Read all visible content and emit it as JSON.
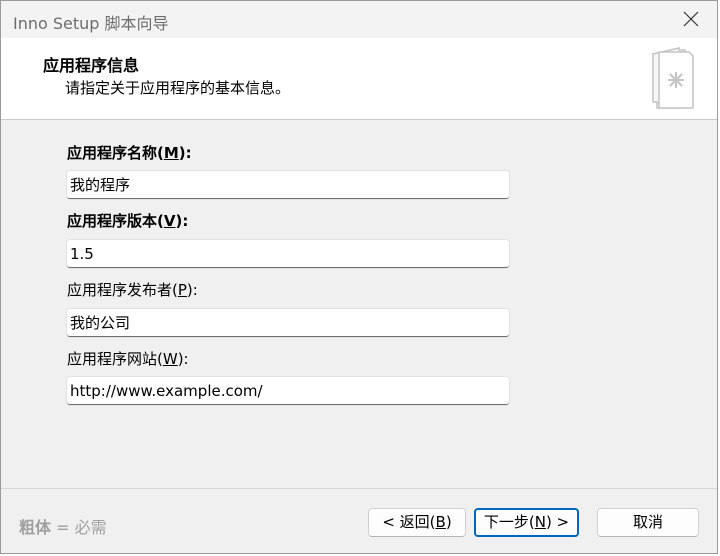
{
  "window": {
    "title": "Inno Setup 脚本向导"
  },
  "header": {
    "title": "应用程序信息",
    "description": "请指定关于应用程序的基本信息。"
  },
  "fields": [
    {
      "label_prefix": "应用程序名称(",
      "mnemonic": "M",
      "label_suffix": "):",
      "value": "我的程序",
      "required": true
    },
    {
      "label_prefix": "应用程序版本(",
      "mnemonic": "V",
      "label_suffix": "):",
      "value": "1.5",
      "required": true
    },
    {
      "label_prefix": "应用程序发布者(",
      "mnemonic": "P",
      "label_suffix": "):",
      "value": "我的公司",
      "required": false
    },
    {
      "label_prefix": "应用程序网站(",
      "mnemonic": "W",
      "label_suffix": "):",
      "value": "http://www.example.com/",
      "required": false
    }
  ],
  "footer": {
    "hint_bold": "粗体",
    "hint_rest": " = 必需"
  },
  "buttons": {
    "back": {
      "prefix": "< 返回(",
      "mnemonic": "B",
      "suffix": ")"
    },
    "next": {
      "prefix": "下一步(",
      "mnemonic": "N",
      "suffix": ") >"
    },
    "cancel": {
      "label": "取消"
    }
  },
  "icons": {
    "close": "close-icon",
    "wizard": "wizard-document-icon"
  },
  "colors": {
    "accent": "#0067c0",
    "header_bg": "#ffffff",
    "window_bg": "#f0f0f0",
    "hint_text": "#a0a0a0"
  }
}
